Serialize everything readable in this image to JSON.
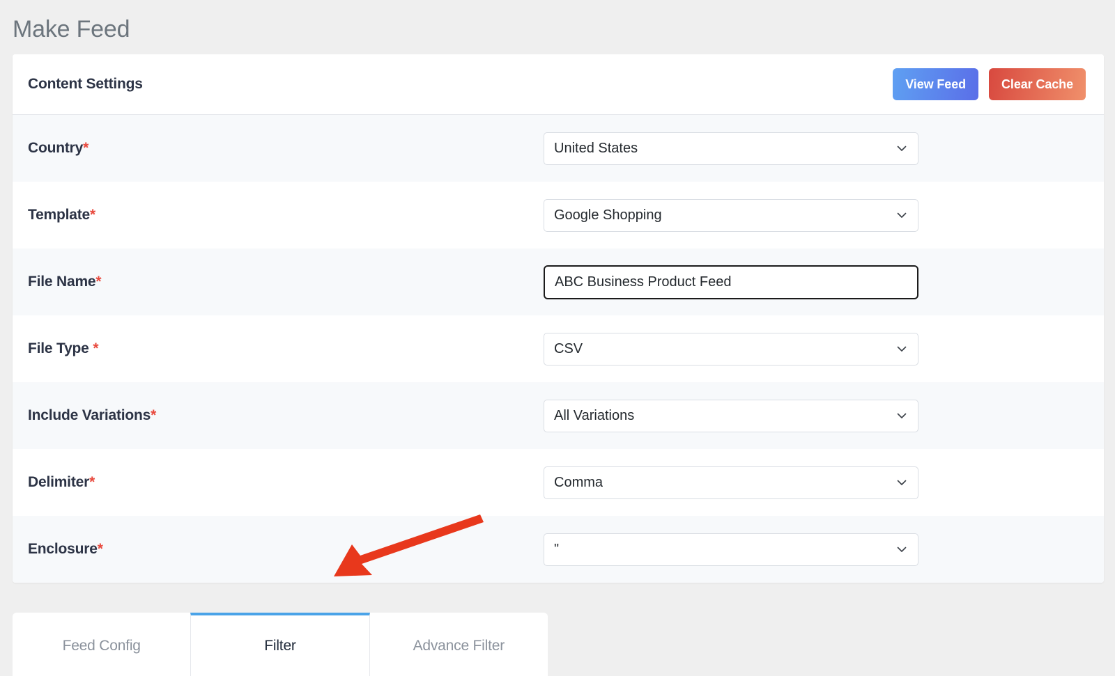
{
  "page": {
    "title": "Make Feed",
    "background_color": "#efefef"
  },
  "card": {
    "header": {
      "title": "Content Settings",
      "buttons": [
        {
          "label": "View Feed",
          "name": "view-feed-button",
          "gradient_from": "#5fa0f2",
          "gradient_to": "#5a6ee8"
        },
        {
          "label": "Clear Cache",
          "name": "clear-cache-button",
          "gradient_from": "#d8493f",
          "gradient_to": "#f0906b"
        }
      ]
    },
    "fields": [
      {
        "label": "Country",
        "required_mark": "*",
        "control": "select",
        "value": "United States",
        "name": "country"
      },
      {
        "label": "Template",
        "required_mark": "*",
        "control": "select",
        "value": "Google Shopping",
        "name": "template"
      },
      {
        "label": "File Name",
        "required_mark": "*",
        "control": "text",
        "value": "ABC Business Product Feed",
        "placeholder": "",
        "focused": true,
        "name": "file-name"
      },
      {
        "label": "File Type ",
        "required_mark": "*",
        "control": "select",
        "value": "CSV",
        "name": "file-type"
      },
      {
        "label": "Include Variations",
        "required_mark": "*",
        "control": "select",
        "value": "All Variations",
        "name": "include-variations"
      },
      {
        "label": "Delimiter",
        "required_mark": "*",
        "control": "select",
        "value": "Comma",
        "name": "delimiter"
      },
      {
        "label": "Enclosure",
        "required_mark": "*",
        "control": "select",
        "value": "\"",
        "name": "enclosure"
      }
    ]
  },
  "tabs": {
    "active_index": 1,
    "active_indicator_color": "#4aa3e8",
    "items": [
      {
        "label": "Feed Config",
        "name": "tab-feed-config"
      },
      {
        "label": "Filter",
        "name": "tab-filter"
      },
      {
        "label": "Advance Filter",
        "name": "tab-advance-filter"
      }
    ]
  },
  "annotation": {
    "type": "arrow",
    "color": "#e8381c",
    "points_to": "tab-filter"
  }
}
